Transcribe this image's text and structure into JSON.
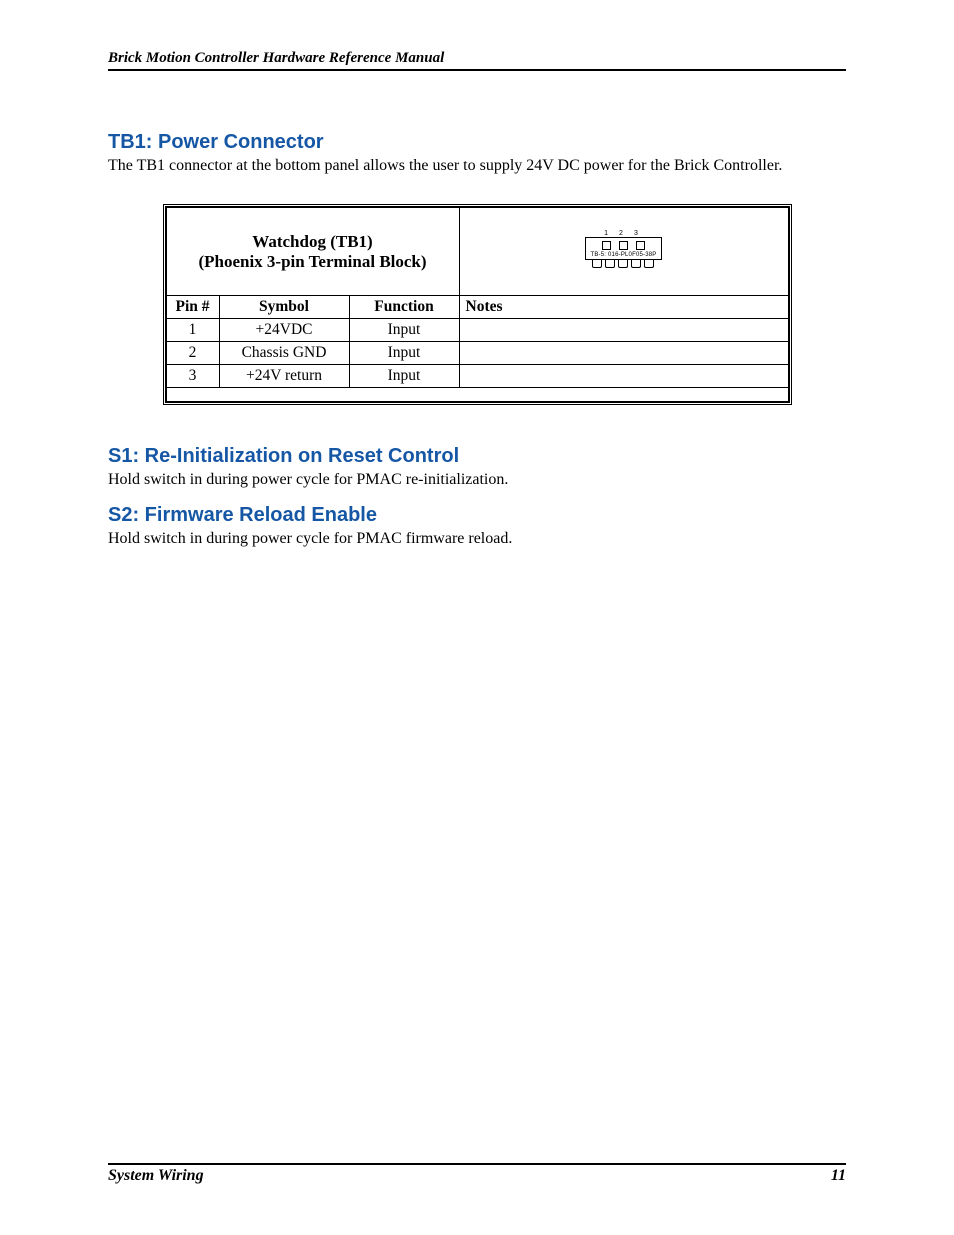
{
  "header": {
    "running_title": "Brick Motion Controller Hardware Reference Manual"
  },
  "sections": {
    "tb1": {
      "heading": "TB1: Power Connector",
      "text": "The TB1 connector at the bottom panel allows the user to supply 24V DC power for the Brick Controller."
    },
    "s1": {
      "heading": "S1:  Re-Initialization on Reset Control",
      "text": "Hold switch in during power cycle for PMAC re-initialization."
    },
    "s2": {
      "heading": "S2:  Firmware Reload Enable",
      "text": "Hold switch in during power cycle for PMAC firmware reload."
    }
  },
  "table": {
    "caption_line1": "Watchdog (TB1)",
    "caption_line2": "(Phoenix 3-pin Terminal Block)",
    "diagram_part_label": "TB-5: 016-PL0F05-38P",
    "diagram_pin_labels": [
      "1",
      "2",
      "3"
    ],
    "columns": {
      "pin": "Pin #",
      "symbol": "Symbol",
      "function": "Function",
      "notes": "Notes"
    },
    "rows": [
      {
        "pin": "1",
        "symbol": "+24VDC",
        "function": "Input",
        "notes": ""
      },
      {
        "pin": "2",
        "symbol": "Chassis GND",
        "function": "Input",
        "notes": ""
      },
      {
        "pin": "3",
        "symbol": "+24V return",
        "function": "Input",
        "notes": ""
      }
    ]
  },
  "footer": {
    "section": "System Wiring",
    "page": "11"
  }
}
